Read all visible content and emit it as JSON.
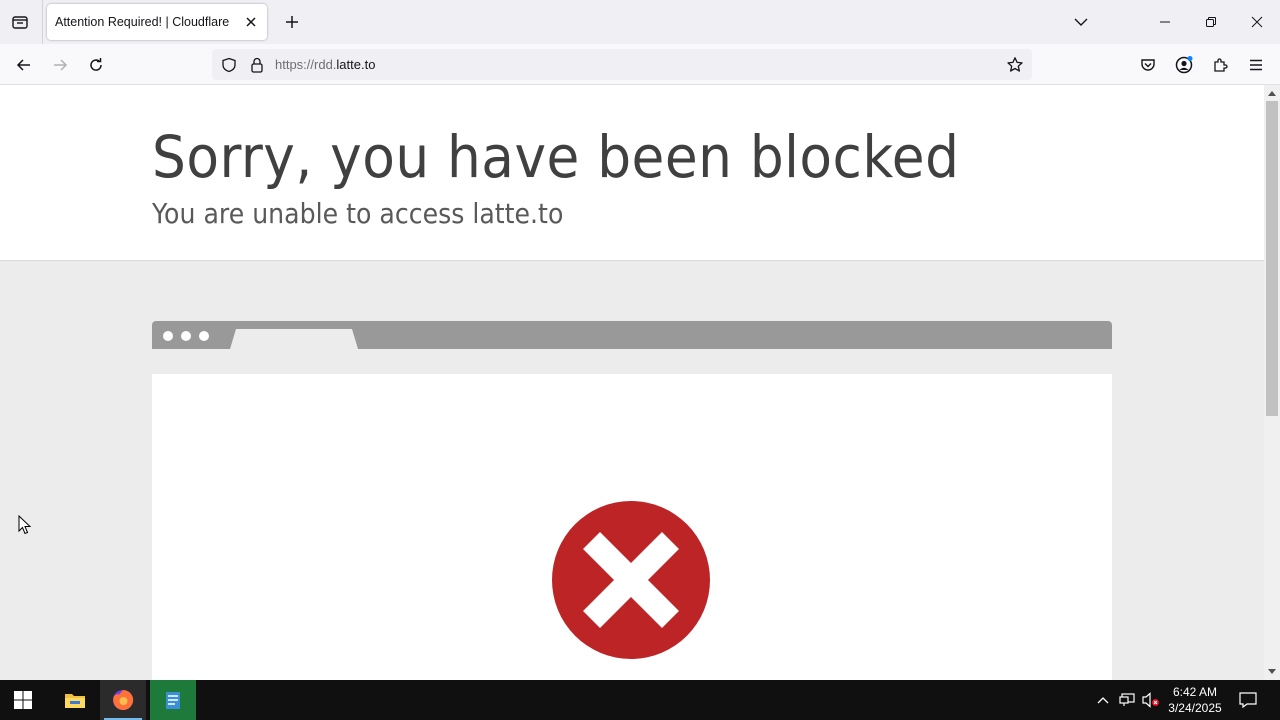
{
  "browser": {
    "tab": {
      "title": "Attention Required! | Cloudflare"
    },
    "url": {
      "prefix": "https://rdd.",
      "host": "latte.to"
    }
  },
  "page": {
    "headline": "Sorry, you have been blocked",
    "subline": "You are unable to access latte.to"
  },
  "taskbar": {
    "time": "6:42 AM",
    "date": "3/24/2025"
  },
  "colors": {
    "error_red": "#bd2426",
    "mock_chrome": "#999999",
    "page_gray": "#ececec"
  },
  "icons": {
    "tabbar": [
      "tab-list-icon",
      "close-icon",
      "plus-icon",
      "chevron-down-icon",
      "minimize-icon",
      "restore-icon",
      "close-window-icon"
    ],
    "navbar": [
      "back-arrow-icon",
      "forward-arrow-icon",
      "reload-icon",
      "shield-icon",
      "lock-icon",
      "star-icon",
      "pocket-icon",
      "account-icon",
      "extensions-icon",
      "menu-icon"
    ],
    "taskbar": [
      "windows-start-icon",
      "file-explorer-icon",
      "firefox-icon",
      "notepad-icon"
    ]
  }
}
